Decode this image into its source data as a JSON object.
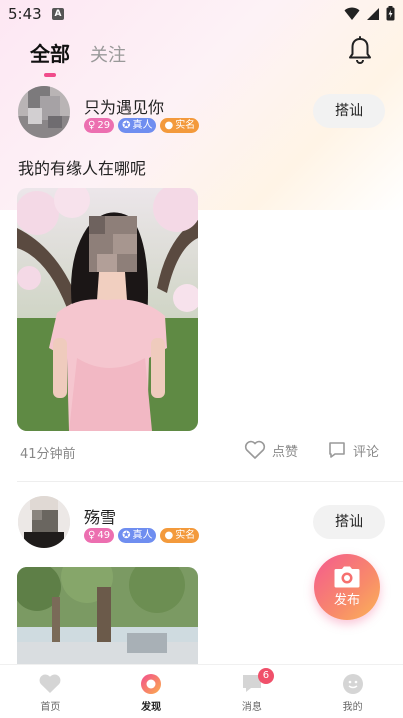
{
  "status_bar": {
    "time": "5:43",
    "app_icon_letter": "A"
  },
  "header": {
    "tabs": [
      {
        "label": "全部",
        "active": true
      },
      {
        "label": "关注",
        "active": false
      }
    ],
    "bell_icon": "bell-icon"
  },
  "posts": [
    {
      "username": "只为遇见你",
      "badges": {
        "age": "29",
        "verified": "真人",
        "realname": "实名"
      },
      "chat_label": "搭讪",
      "text": "我的有缘人在哪呢",
      "time": "41分钟前",
      "like_label": "点赞",
      "comment_label": "评论"
    },
    {
      "username": "殇雪",
      "badges": {
        "age": "49",
        "verified": "真人",
        "realname": "实名"
      },
      "chat_label": "搭讪"
    }
  ],
  "fab": {
    "label": "发布",
    "icon": "camera-icon"
  },
  "bottom_nav": {
    "items": [
      {
        "label": "首页",
        "icon": "heart-icon"
      },
      {
        "label": "发现",
        "icon": "discover-icon",
        "active": true
      },
      {
        "label": "消息",
        "icon": "message-icon",
        "badge": "6"
      },
      {
        "label": "我的",
        "icon": "profile-icon"
      }
    ]
  },
  "colors": {
    "accent": "#f04c8b",
    "badge_pink": "#ec6fb0",
    "badge_blue": "#6f8ef0",
    "badge_orange": "#f39a3c"
  }
}
